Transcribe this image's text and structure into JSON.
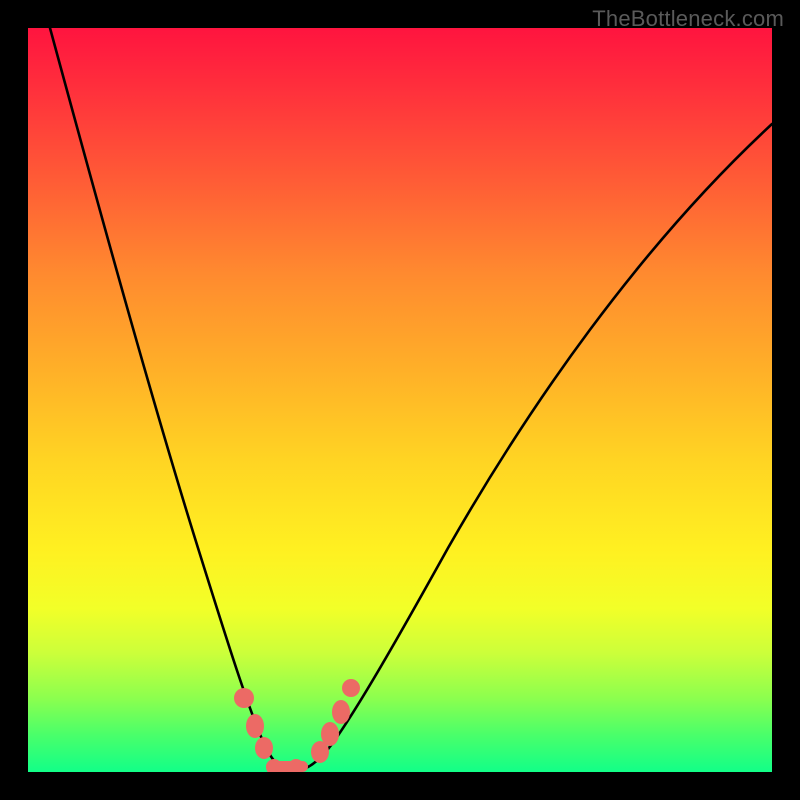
{
  "watermark": "TheBottleneck.com",
  "colors": {
    "frame": "#000000",
    "curve": "#000000",
    "marker": "#ec6a65",
    "gradient_top": "#ff143f",
    "gradient_bottom": "#12ff88"
  },
  "chart_data": {
    "type": "line",
    "title": "",
    "xlabel": "",
    "ylabel": "",
    "xlim": [
      0,
      100
    ],
    "ylim": [
      0,
      100
    ],
    "legend": false,
    "grid": false,
    "series": [
      {
        "name": "left-branch",
        "x": [
          3,
          6,
          9,
          12,
          15,
          18,
          21,
          24,
          26,
          28,
          29.5,
          31,
          32.5
        ],
        "values": [
          100,
          87,
          74,
          62,
          50,
          39,
          28,
          18,
          11,
          6,
          3,
          1,
          0.5
        ]
      },
      {
        "name": "right-branch",
        "x": [
          36,
          38,
          40,
          43,
          47,
          52,
          58,
          65,
          73,
          82,
          91,
          100
        ],
        "values": [
          0.5,
          2,
          5,
          10,
          18,
          28,
          39,
          50,
          61,
          71,
          80,
          87
        ]
      }
    ],
    "markers": [
      {
        "series": "left-branch",
        "x": 27.5,
        "y": 9
      },
      {
        "series": "left-branch",
        "x": 29,
        "y": 5
      },
      {
        "series": "left-branch",
        "x": 30.5,
        "y": 2
      },
      {
        "series": "left-branch",
        "x": 32,
        "y": 1
      },
      {
        "series": "right-branch",
        "x": 34,
        "y": 0.5
      },
      {
        "series": "right-branch",
        "x": 36.5,
        "y": 1
      },
      {
        "series": "right-branch",
        "x": 38.5,
        "y": 3
      },
      {
        "series": "right-branch",
        "x": 40,
        "y": 6
      },
      {
        "series": "right-branch",
        "x": 41.5,
        "y": 9
      },
      {
        "series": "right-branch",
        "x": 43,
        "y": 12
      }
    ],
    "annotations": []
  }
}
